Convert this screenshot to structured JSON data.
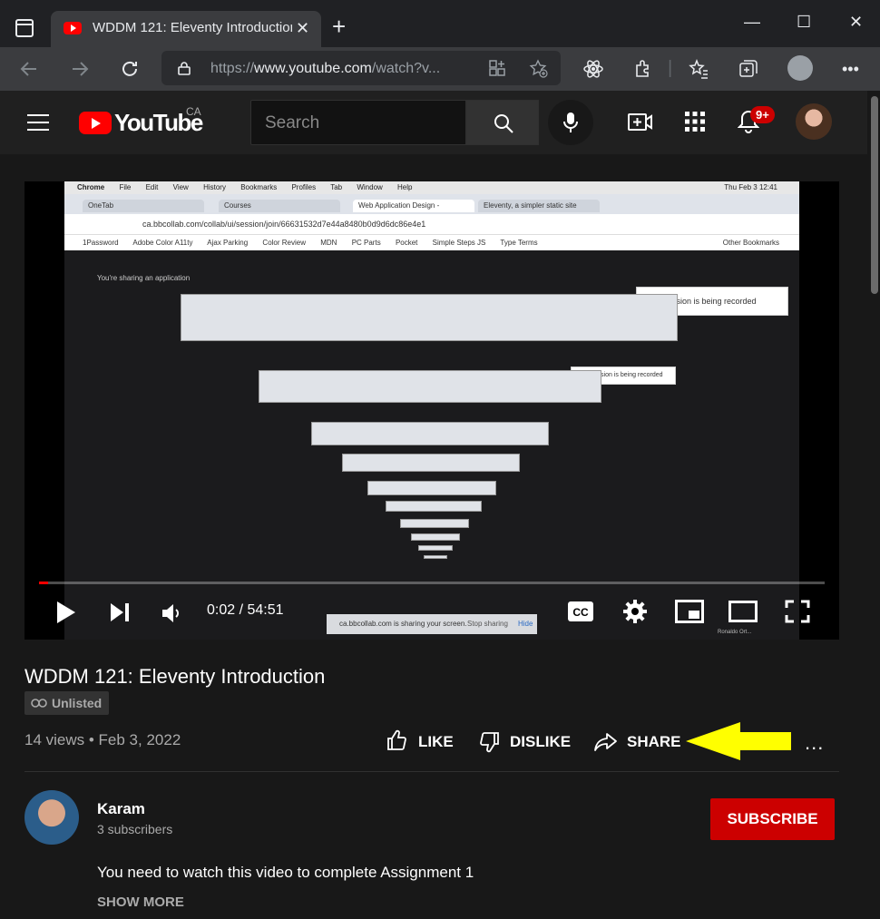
{
  "browser": {
    "tab_title": "WDDM 121: Eleventy Introduction",
    "tab_close": "✕",
    "new_tab": "+",
    "window_controls": [
      "—",
      "☐",
      "✕"
    ],
    "url_prefix": "https://",
    "url_host": "www.youtube.com",
    "url_path": "/watch?v..."
  },
  "yt_header": {
    "logo_text": "YouTube",
    "country": "CA",
    "search_placeholder": "Search",
    "notification_count": "9+"
  },
  "player": {
    "time": "0:02 / 54:51",
    "progress_fraction": 0.0006,
    "inner": {
      "mac_menu": [
        "Chrome",
        "File",
        "Edit",
        "View",
        "History",
        "Bookmarks",
        "Profiles",
        "Tab",
        "Window",
        "Help"
      ],
      "mac_status": "Thu Feb 3  12:41",
      "tabs": [
        "OneTab",
        "Courses",
        "Web Application Design -",
        "Eleventy, a simpler static site"
      ],
      "url": "ca.bbcollab.com/collab/ui/session/join/66631532d7e44a8480b0d9d6dc86e4e1",
      "bookmarks": [
        "1Password",
        "Adobe Color A11ty",
        "Ajax Parking",
        "Color Review",
        "MDN",
        "PC Parts",
        "Pocket",
        "Simple Steps JS",
        "Type Terms",
        "Other Bookmarks"
      ],
      "sharing_note": "You're sharing an application",
      "recording": "Session is being recorded",
      "sharebar_text": "ca.bbcollab.com is sharing your screen.",
      "sharebar_stop": "Stop sharing",
      "sharebar_hide": "Hide",
      "participant": "Ronaldo Ort..."
    }
  },
  "video": {
    "title": "WDDM 121: Eleventy Introduction",
    "visibility": "Unlisted",
    "stats": "14 views • Feb 3, 2022",
    "like": "LIKE",
    "dislike": "DISLIKE",
    "share": "SHARE",
    "more": "..."
  },
  "channel": {
    "name": "Karam",
    "subscribers": "3 subscribers",
    "subscribe": "SUBSCRIBE"
  },
  "description": {
    "text": "You need to watch this video to complete Assignment 1",
    "show_more": "SHOW MORE"
  },
  "colors": {
    "accent": "#ff0000",
    "subscribe": "#cc0000",
    "highlight_arrow": "#ffff00"
  }
}
